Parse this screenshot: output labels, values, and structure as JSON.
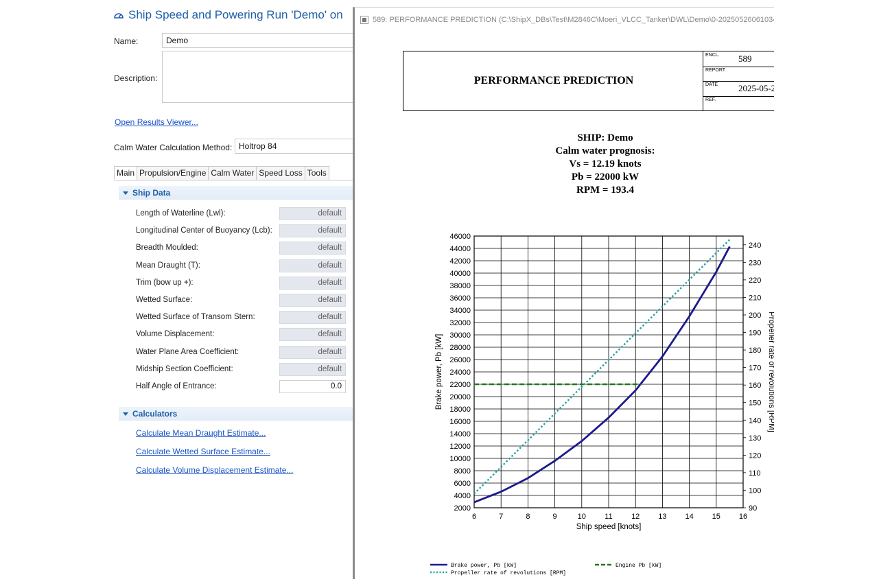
{
  "form": {
    "title": "Ship Speed and Powering Run 'Demo' on",
    "name_label": "Name:",
    "name_value": "Demo",
    "description_label": "Description:",
    "description_value": "",
    "open_results_link": "Open Results Viewer...",
    "calc_method_label": "Calm Water Calculation Method:",
    "calc_method_value": "Holtrop 84",
    "tabs": [
      {
        "label": "Main",
        "active": true
      },
      {
        "label": "Propulsion/Engine",
        "active": false
      },
      {
        "label": "Calm Water",
        "active": false
      },
      {
        "label": "Speed Loss",
        "active": false
      },
      {
        "label": "Tools",
        "active": false
      }
    ],
    "ship_data_header": "Ship Data",
    "ship_data": [
      {
        "label": "Length of Waterline (Lwl):",
        "value": "default"
      },
      {
        "label": "Longitudinal Center of Buoyancy (Lcb):",
        "value": "default"
      },
      {
        "label": "Breadth Moulded:",
        "value": "default"
      },
      {
        "label": "Mean Draught (T):",
        "value": "default"
      },
      {
        "label": "Trim (bow up +):",
        "value": "default"
      },
      {
        "label": "Wetted Surface:",
        "value": "default"
      },
      {
        "label": "Wetted Surface of Transom Stern:",
        "value": "default"
      },
      {
        "label": "Volume Displacement:",
        "value": "default"
      },
      {
        "label": "Water Plane Area Coefficient:",
        "value": "default"
      },
      {
        "label": "Midship Section Coefficient:",
        "value": "default"
      },
      {
        "label": "Half Angle of Entrance:",
        "value": "0.0"
      }
    ],
    "calculators_header": "Calculators",
    "calculators": [
      "Calculate Mean Draught Estimate...",
      "Calculate Wetted Surface Estimate...",
      "Calculate Volume Displacement Estimate..."
    ]
  },
  "report": {
    "window_title": "589: PERFORMANCE PREDICTION (C:\\ShipX_DBs\\Test\\M2846C\\Moeri_VLCC_Tanker\\DWL\\Demo\\0-20250526061034",
    "header_title": "PERFORMANCE PREDICTION",
    "encl_label": "ENCL.",
    "encl_value": "589",
    "report_label": "REPORT",
    "report_value": "",
    "date_label": "DATE",
    "date_value": "2025-05-2",
    "ref_label": "REF.",
    "ref_value": "",
    "ship_line": "SHIP:    Demo",
    "prognosis_line": "Calm water prognosis:",
    "vs_line": "Vs = 12.19 knots",
    "pb_line": "Pb = 22000 kW",
    "rpm_line": "RPM = 193.4"
  },
  "chart_data": {
    "type": "line",
    "xlabel": "Ship speed [knots]",
    "ylabel": "Brake power, Pb [kW]",
    "y2label": "Propeller rate of revolutions [RPM]",
    "xlim": [
      6,
      16
    ],
    "ylim": [
      2000,
      46000
    ],
    "y2lim": [
      90,
      245
    ],
    "x_ticks": [
      6,
      7,
      8,
      9,
      10,
      11,
      12,
      13,
      14,
      15,
      16
    ],
    "y_ticks": [
      2000,
      4000,
      6000,
      8000,
      10000,
      12000,
      14000,
      16000,
      18000,
      20000,
      22000,
      24000,
      26000,
      28000,
      30000,
      32000,
      34000,
      36000,
      38000,
      40000,
      42000,
      44000,
      46000
    ],
    "y2_ticks": [
      90,
      100,
      110,
      120,
      130,
      140,
      150,
      160,
      170,
      180,
      190,
      200,
      210,
      220,
      230,
      240
    ],
    "grid": true,
    "series": [
      {
        "name": "Brake power, Pb [kW]",
        "axis": "left",
        "color": "#1a1a8c",
        "style": "solid",
        "x": [
          6,
          7,
          8,
          9,
          10,
          11,
          12,
          13,
          14,
          15,
          15.5
        ],
        "y": [
          2900,
          4600,
          6800,
          9600,
          12800,
          16600,
          21000,
          26500,
          33000,
          40200,
          44300
        ]
      },
      {
        "name": "Engine Pb [kW]",
        "axis": "left",
        "color": "#1e7a1e",
        "style": "dashed",
        "x": [
          6,
          12.19
        ],
        "y": [
          22000,
          22000
        ]
      },
      {
        "name": "Propeller rate of revolutions [RPM]",
        "axis": "right",
        "color": "#1fa0a0",
        "style": "dotted",
        "x": [
          6,
          15.5
        ],
        "y": [
          98,
          243
        ]
      }
    ]
  }
}
